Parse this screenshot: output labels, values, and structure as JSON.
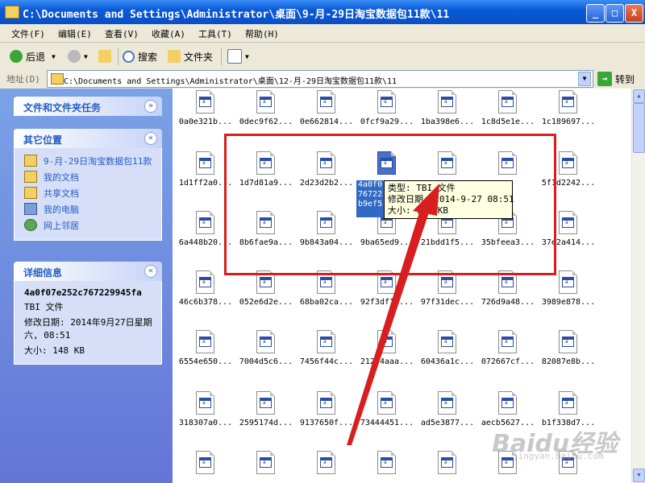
{
  "window": {
    "title": "C:\\Documents and Settings\\Administrator\\桌面\\9-月-29日淘宝数据包11款\\11",
    "controls": {
      "minimize": "_",
      "maximize": "□",
      "close": "X"
    }
  },
  "menu": [
    {
      "label": "文件(F)"
    },
    {
      "label": "编辑(E)"
    },
    {
      "label": "查看(V)"
    },
    {
      "label": "收藏(A)"
    },
    {
      "label": "工具(T)"
    },
    {
      "label": "帮助(H)"
    }
  ],
  "toolbar": {
    "back": "后退",
    "search": "搜索",
    "folders": "文件夹"
  },
  "address": {
    "label": "地址(D)",
    "value": "C:\\Documents and Settings\\Administrator\\桌面\\12-月-29日淘宝数据包11款\\11",
    "go": "转到"
  },
  "sidebar": {
    "tasks": {
      "title": "文件和文件夹任务"
    },
    "places": {
      "title": "其它位置",
      "items": [
        {
          "label": "9-月-29日淘宝数据包11款",
          "icon": "folder-icon"
        },
        {
          "label": "我的文档",
          "icon": "folder-icon"
        },
        {
          "label": "共享文档",
          "icon": "folder-icon"
        },
        {
          "label": "我的电脑",
          "icon": "computer-icon"
        },
        {
          "label": "网上邻居",
          "icon": "network-icon"
        }
      ]
    },
    "details": {
      "title": "详细信息",
      "name": "4a0f07e252c767229945fa",
      "type": "TBI 文件",
      "modified": "修改日期: 2014年9月27日星期六, 08:51",
      "size": "大小: 148 KB"
    }
  },
  "files": [
    [
      "0a0e321b...",
      "0dec9f62...",
      "0e662814...",
      "0fcf9a29...",
      "1ba398e6...",
      "1c8d5e1e...",
      "1c189697..."
    ],
    [
      "1d1ff2a0...",
      "1d7d81a9...",
      "2d23d2b2...",
      "",
      "",
      "",
      "5f1d2242..."
    ],
    [
      "6a448b20...",
      "8b6fae9a...",
      "9b843a04...",
      "9ba65ed9...",
      "21bdd1f5...",
      "35bfeea3...",
      "37e2a414..."
    ],
    [
      "46c6b378...",
      "052e6d2e...",
      "68ba02ca...",
      "92f3df1f...",
      "97f31dec...",
      "726d9a48...",
      "3989e878..."
    ],
    [
      "6554e650...",
      "7004d5c6...",
      "7456f44c...",
      "21274aaa...",
      "60436a1c...",
      "072667cf...",
      "82087e8b..."
    ],
    [
      "318307a0...",
      "2595174d...",
      "9137650f...",
      "73444451...",
      "ad5e3877...",
      "aecb5627...",
      "b1f338d7..."
    ],
    [
      "",
      "",
      "",
      "",
      "",
      "",
      ""
    ]
  ],
  "selected_file": {
    "lines": [
      "4a0f0",
      "76722",
      "b9ef5",
      "t"
    ]
  },
  "tooltip": {
    "type": "类型: TBI 文件",
    "modified": "修改日期: 2014-9-27 08:51",
    "size": "大小: 148 KB"
  },
  "watermark": {
    "main": "Baidu经验",
    "sub": "jingyan.baidu.com"
  },
  "colors": {
    "highlight_box": "#d81e1e",
    "arrow": "#d81e1e",
    "title_bar": "#0a5bd8",
    "sidebar": "#7ba2e7"
  }
}
